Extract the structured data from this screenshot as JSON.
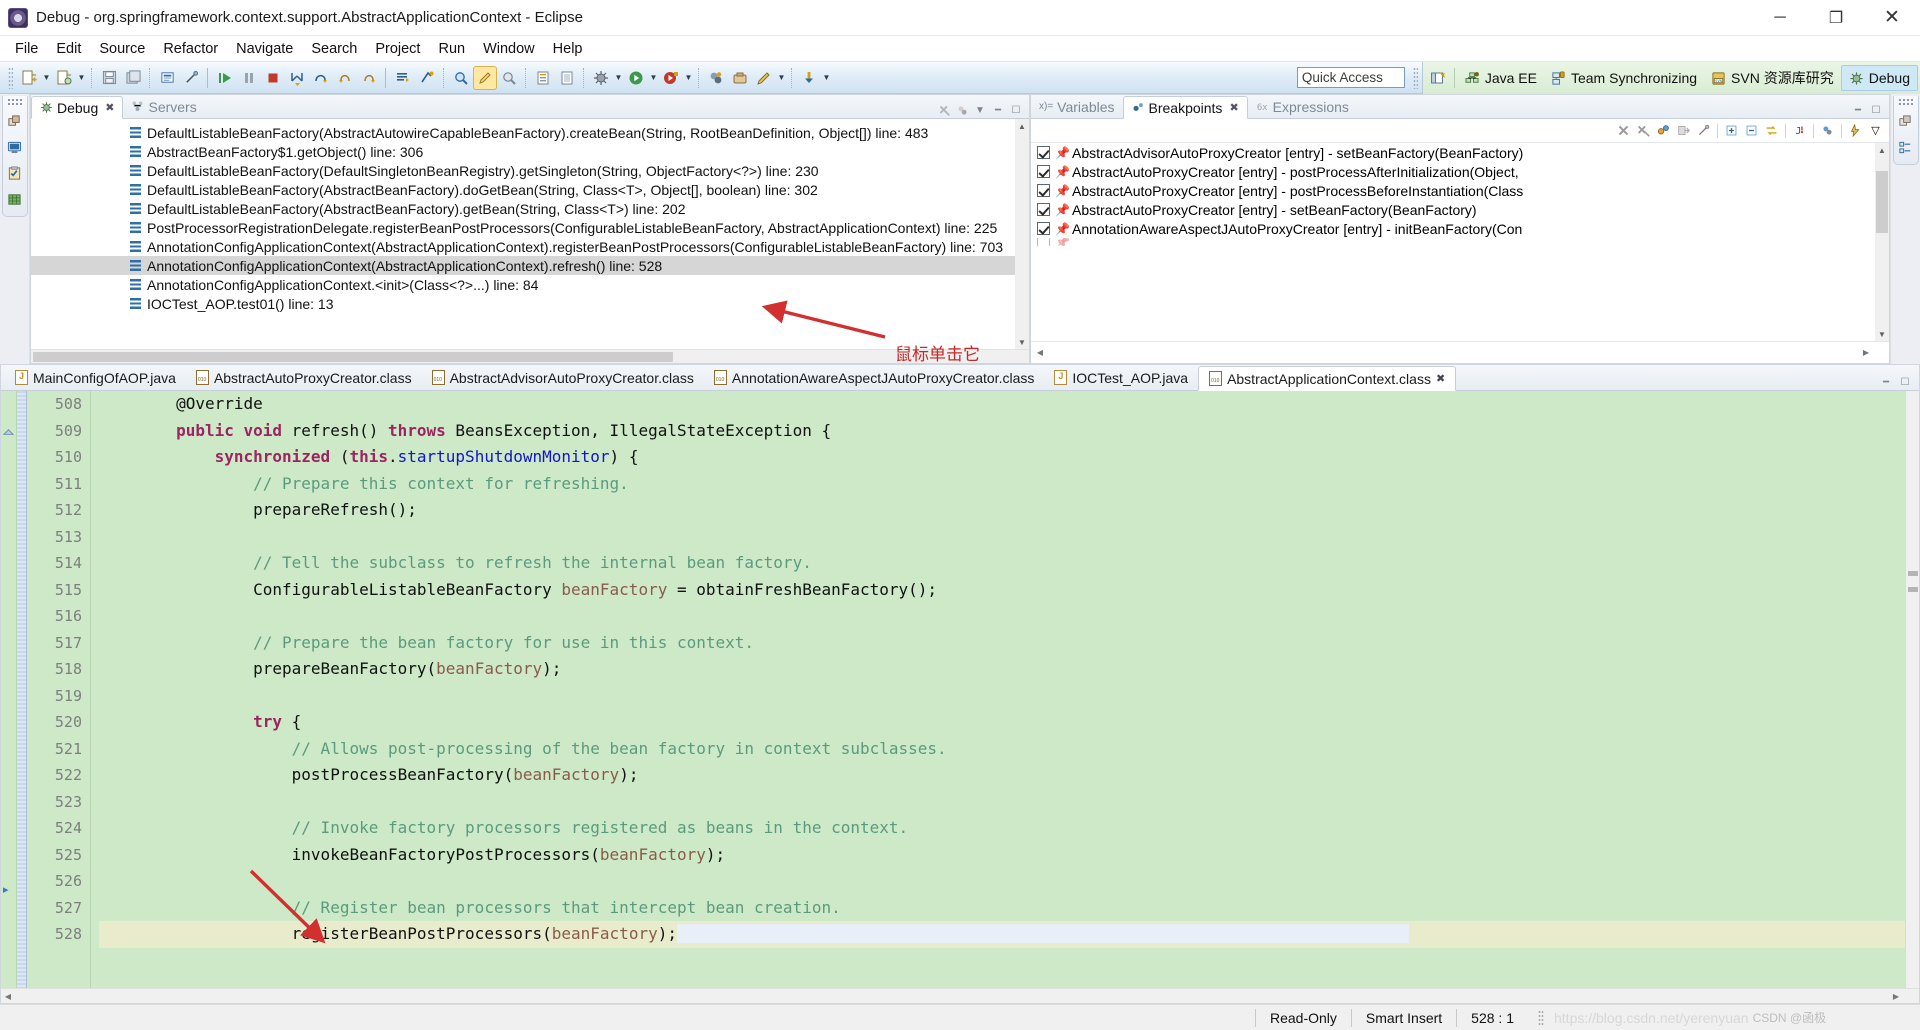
{
  "window": {
    "title": "Debug - org.springframework.context.support.AbstractApplicationContext - Eclipse",
    "app_icon": "eclipse-icon",
    "minimize": "─",
    "maximize": "❐",
    "close": "✕"
  },
  "menubar": [
    "File",
    "Edit",
    "Source",
    "Refactor",
    "Navigate",
    "Search",
    "Project",
    "Run",
    "Window",
    "Help"
  ],
  "toolbar": {
    "quick_access_placeholder": "Quick Access",
    "quick_access_value": "Quick Access"
  },
  "perspectives": {
    "open_perspective_icon": "open-perspective-icon",
    "items": [
      {
        "label": "Java EE",
        "icon": "java-ee-icon",
        "active": false
      },
      {
        "label": "Team Synchronizing",
        "icon": "team-sync-icon",
        "active": false
      },
      {
        "label": "SVN 资源库研究",
        "icon": "svn-icon",
        "active": false
      },
      {
        "label": "Debug",
        "icon": "debug-icon",
        "active": true
      }
    ]
  },
  "debug_view": {
    "tabs": [
      {
        "label": "Debug",
        "icon": "debug-icon",
        "active": true,
        "closeable": true
      },
      {
        "label": "Servers",
        "icon": "servers-icon",
        "active": false,
        "closeable": false
      }
    ],
    "stack_frames": [
      {
        "text": "DefaultListableBeanFactory(AbstractAutowireCapableBeanFactory).createBean(String, RootBeanDefinition, Object[]) line: 483",
        "selected": false
      },
      {
        "text": "AbstractBeanFactory$1.getObject() line: 306",
        "selected": false
      },
      {
        "text": "DefaultListableBeanFactory(DefaultSingletonBeanRegistry).getSingleton(String, ObjectFactory<?>) line: 230",
        "selected": false
      },
      {
        "text": "DefaultListableBeanFactory(AbstractBeanFactory).doGetBean(String, Class<T>, Object[], boolean) line: 302",
        "selected": false
      },
      {
        "text": "DefaultListableBeanFactory(AbstractBeanFactory).getBean(String, Class<T>) line: 202",
        "selected": false
      },
      {
        "text": "PostProcessorRegistrationDelegate.registerBeanPostProcessors(ConfigurableListableBeanFactory, AbstractApplicationContext) line: 225",
        "selected": false
      },
      {
        "text": "AnnotationConfigApplicationContext(AbstractApplicationContext).registerBeanPostProcessors(ConfigurableListableBeanFactory) line: 703",
        "selected": false
      },
      {
        "text": "AnnotationConfigApplicationContext(AbstractApplicationContext).refresh() line: 528",
        "selected": true
      },
      {
        "text": "AnnotationConfigApplicationContext.<init>(Class<?>...) line: 84",
        "selected": false
      },
      {
        "text": "IOCTest_AOP.test01() line: 13",
        "selected": false
      }
    ]
  },
  "breakpoints_view": {
    "tabs": [
      {
        "label": "Variables",
        "icon": "variables-icon",
        "active": false,
        "closeable": false
      },
      {
        "label": "Breakpoints",
        "icon": "breakpoints-icon",
        "active": true,
        "closeable": true
      },
      {
        "label": "Expressions",
        "icon": "expressions-icon",
        "active": false,
        "closeable": false
      }
    ],
    "toolbar_icons": [
      "remove-breakpoint-icon",
      "remove-all-breakpoints-icon",
      "link-with-debug-view-icon",
      "show-in-editor-icon",
      "skip-all-breakpoints-icon",
      "expand-all-icon",
      "collapse-all-icon",
      "working-sets-icon",
      "add-exception-breakpoint-icon",
      "add-java-exception-icon",
      "breakpoint-props-icon",
      "view-menu-icon"
    ],
    "items": [
      {
        "label": "AbstractAdvisorAutoProxyCreator [entry] - setBeanFactory(BeanFactory)",
        "checked": true
      },
      {
        "label": "AbstractAutoProxyCreator [entry] - postProcessAfterInitialization(Object,",
        "checked": true
      },
      {
        "label": "AbstractAutoProxyCreator [entry] - postProcessBeforeInstantiation(Class",
        "checked": true
      },
      {
        "label": "AbstractAutoProxyCreator [entry] - setBeanFactory(BeanFactory)",
        "checked": true
      },
      {
        "label": "AnnotationAwareAspectJAutoProxyCreator [entry] - initBeanFactory(Con",
        "checked": true
      }
    ]
  },
  "editor": {
    "tabs": [
      {
        "label": "MainConfigOfAOP.java",
        "icon": "java-file-icon",
        "active": false
      },
      {
        "label": "AbstractAutoProxyCreator.class",
        "icon": "class-file-icon",
        "active": false
      },
      {
        "label": "AbstractAdvisorAutoProxyCreator.class",
        "icon": "class-file-icon",
        "active": false
      },
      {
        "label": "AnnotationAwareAspectJAutoProxyCreator.class",
        "icon": "class-file-icon",
        "active": false
      },
      {
        "label": "IOCTest_AOP.java",
        "icon": "java-file-icon",
        "active": false
      },
      {
        "label": "AbstractApplicationContext.class",
        "icon": "class-file-icon",
        "active": true
      }
    ],
    "first_line": 508,
    "current_line": 528,
    "lines": [
      {
        "n": 508,
        "indent": 2,
        "segments": [
          {
            "t": "@Override",
            "c": "pl"
          }
        ]
      },
      {
        "n": 509,
        "indent": 2,
        "segments": [
          {
            "t": "public",
            "c": "kw"
          },
          {
            "t": " ",
            "c": "pl"
          },
          {
            "t": "void",
            "c": "kw"
          },
          {
            "t": " refresh() ",
            "c": "pl"
          },
          {
            "t": "throws",
            "c": "kw"
          },
          {
            "t": " BeansException, IllegalStateException {",
            "c": "pl"
          }
        ]
      },
      {
        "n": 510,
        "indent": 3,
        "segments": [
          {
            "t": "synchronized",
            "c": "kw"
          },
          {
            "t": " (",
            "c": "pl"
          },
          {
            "t": "this",
            "c": "kw"
          },
          {
            "t": ".",
            "c": "pl"
          },
          {
            "t": "startupShutdownMonitor",
            "c": "fld"
          },
          {
            "t": ") {",
            "c": "pl"
          }
        ]
      },
      {
        "n": 511,
        "indent": 4,
        "segments": [
          {
            "t": "// Prepare this context for refreshing.",
            "c": "cm"
          }
        ]
      },
      {
        "n": 512,
        "indent": 4,
        "segments": [
          {
            "t": "prepareRefresh();",
            "c": "pl"
          }
        ]
      },
      {
        "n": 513,
        "indent": 0,
        "segments": []
      },
      {
        "n": 514,
        "indent": 4,
        "segments": [
          {
            "t": "// Tell the subclass to refresh the internal bean factory.",
            "c": "cm"
          }
        ]
      },
      {
        "n": 515,
        "indent": 4,
        "segments": [
          {
            "t": "ConfigurableListableBeanFactory ",
            "c": "pl"
          },
          {
            "t": "beanFactory",
            "c": "var"
          },
          {
            "t": " = obtainFreshBeanFactory();",
            "c": "pl"
          }
        ]
      },
      {
        "n": 516,
        "indent": 0,
        "segments": []
      },
      {
        "n": 517,
        "indent": 4,
        "segments": [
          {
            "t": "// Prepare the bean factory for use in this context.",
            "c": "cm"
          }
        ]
      },
      {
        "n": 518,
        "indent": 4,
        "segments": [
          {
            "t": "prepareBeanFactory(",
            "c": "pl"
          },
          {
            "t": "beanFactory",
            "c": "var"
          },
          {
            "t": ");",
            "c": "pl"
          }
        ]
      },
      {
        "n": 519,
        "indent": 0,
        "segments": []
      },
      {
        "n": 520,
        "indent": 4,
        "segments": [
          {
            "t": "try",
            "c": "kw"
          },
          {
            "t": " {",
            "c": "pl"
          }
        ]
      },
      {
        "n": 521,
        "indent": 5,
        "segments": [
          {
            "t": "// Allows post-processing of the bean factory in context subclasses.",
            "c": "cm"
          }
        ]
      },
      {
        "n": 522,
        "indent": 5,
        "segments": [
          {
            "t": "postProcessBeanFactory(",
            "c": "pl"
          },
          {
            "t": "beanFactory",
            "c": "var"
          },
          {
            "t": ");",
            "c": "pl"
          }
        ]
      },
      {
        "n": 523,
        "indent": 0,
        "segments": []
      },
      {
        "n": 524,
        "indent": 5,
        "segments": [
          {
            "t": "// Invoke factory processors registered as beans in the context.",
            "c": "cm"
          }
        ]
      },
      {
        "n": 525,
        "indent": 5,
        "segments": [
          {
            "t": "invokeBeanFactoryPostProcessors(",
            "c": "pl"
          },
          {
            "t": "beanFactory",
            "c": "var"
          },
          {
            "t": ");",
            "c": "pl"
          }
        ]
      },
      {
        "n": 526,
        "indent": 0,
        "segments": []
      },
      {
        "n": 527,
        "indent": 5,
        "segments": [
          {
            "t": "// Register bean processors that intercept bean creation.",
            "c": "cm"
          }
        ]
      },
      {
        "n": 528,
        "indent": 5,
        "current": true,
        "segments": [
          {
            "t": "registerBeanPostProcessors(",
            "c": "pl"
          },
          {
            "t": "beanFactory",
            "c": "var"
          },
          {
            "t": ");",
            "c": "pl"
          }
        ]
      }
    ]
  },
  "statusbar": {
    "read_only": "Read-Only",
    "insert_mode": "Smart Insert",
    "cursor_position": "528 : 1",
    "watermark": "https://blog.csdn.net/yerenyuan",
    "csdn": "CSDN @函极"
  },
  "annotations": [
    {
      "name": "stack-frame-arrow-note",
      "text": "鼠标单击它",
      "color": "#d32f2f"
    }
  ],
  "colors": {
    "code_background": "#cde9c8",
    "current_line": "#e8eccc",
    "selection": "#d6d6d6",
    "annotation_red": "#d32f2f",
    "keyword": "#9c2561",
    "comment": "#5a9b7e",
    "field": "#1414c8",
    "local_var": "#8a5b4a"
  }
}
